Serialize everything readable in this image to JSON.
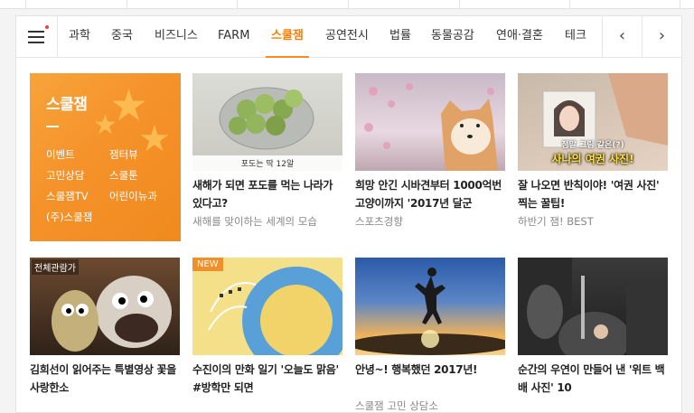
{
  "nav": {
    "tabs": [
      "과학",
      "중국",
      "비즈니스",
      "FARM",
      "스쿨잼",
      "공연전시",
      "법률",
      "동물공감",
      "연애·결혼",
      "테크"
    ],
    "active_index": 4,
    "prev_arrow": "‹",
    "next_arrow": "›"
  },
  "promo": {
    "title": "스쿨잼",
    "links": [
      "이벤트",
      "잼터뷰",
      "고민상담",
      "스쿨툰",
      "스쿨잼TV",
      "어린이뉴과",
      "(주)스쿨잼"
    ]
  },
  "articles": [
    {
      "title": "새해가 되면 포도를 먹는 나라가 있다고?",
      "source": "새해를 맞이하는 세계의 모습",
      "caption": "포도는 딱 12알"
    },
    {
      "title": "희망 안긴 시바견부터 1000억번 고양이까지 '2017년 달군",
      "source": "스포츠경향"
    },
    {
      "title": "잘 나오면 반칙이야! '여권 사진' 찍는 꿀팁!",
      "source": "하반기 잼! BEST",
      "overlay1": "정말 그림 같은(?)",
      "overlay2": "사나의 여권 사진!"
    },
    {
      "title": "김희선이 읽어주는 특별영상 꽃을 사랑한소",
      "source": "",
      "corner": "전체관람가"
    },
    {
      "title": "수진이의 만화 일기 '오늘도 맑음' #방학만 되면",
      "source": "",
      "badge": "NEW"
    },
    {
      "title": "안녕~! 행복했던 2017년!",
      "source": "스쿨잼 고민 상담소"
    },
    {
      "title": "순간의 우연이 만들어 낸 '위트 백배 사진' 10",
      "source": ""
    }
  ],
  "colors": {
    "accent": "#ff7d00",
    "promo_bg": "#f5922a"
  }
}
